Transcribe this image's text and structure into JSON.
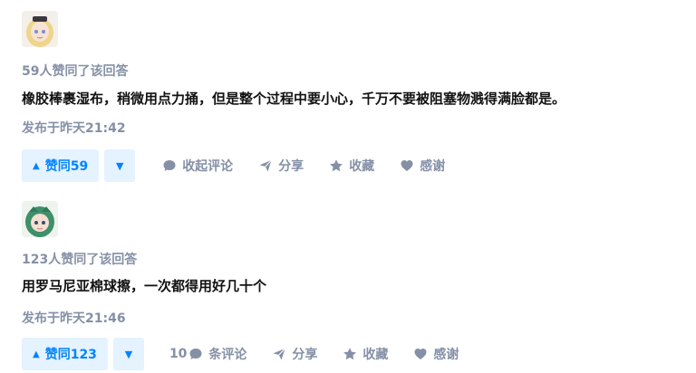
{
  "answers": [
    {
      "votes_text": "59人赞同了该回答",
      "content": "橡胶棒裹湿布，稍微用点力捅，但是整个过程中要小心，千万不要被阻塞物溅得满脸都是。",
      "time": "发布于昨天21:42",
      "vote_up_label": "赞同59",
      "comment_label": "收起评论",
      "share_label": "分享",
      "collect_label": "收藏",
      "thank_label": "感谢"
    },
    {
      "votes_text": "123人赞同了该回答",
      "content": "用罗马尼亚棉球擦，一次都得用好几十个",
      "time": "发布于昨天21:46",
      "vote_up_label": "赞同123",
      "comment_count": "10",
      "comment_label": "条评论",
      "share_label": "分享",
      "collect_label": "收藏",
      "thank_label": "感谢"
    }
  ],
  "icons": {
    "vote_up": "triangle-up-icon",
    "vote_down": "triangle-down-icon",
    "comment": "comment-bubble-icon",
    "share": "paper-plane-icon",
    "collect": "star-icon",
    "thank": "heart-icon"
  },
  "colors": {
    "accent": "#0084ff",
    "accent_bg": "#e5f2ff",
    "meta": "#8590a6",
    "text": "#121212"
  }
}
